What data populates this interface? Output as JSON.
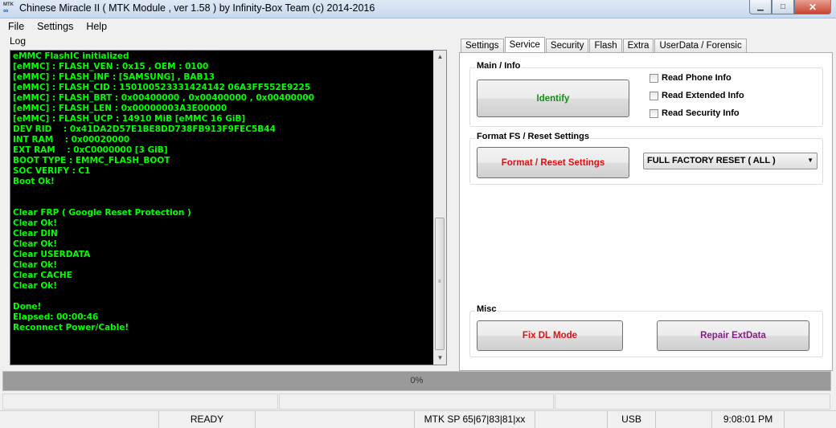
{
  "window": {
    "title": "Chinese Miracle II ( MTK Module , ver 1.58 ) by Infinity-Box Team (c) 2014-2016",
    "controls": [
      "minimize",
      "maximize",
      "close"
    ]
  },
  "menu": [
    "File",
    "Settings",
    "Help"
  ],
  "log": {
    "label": "Log",
    "lines": [
      "eMMC FlashIC initialized",
      "[eMMC] : FLASH_VEN : 0x15 , OEM : 0100",
      "[eMMC] : FLASH_INF : [SAMSUNG] , BAB13",
      "[eMMC] : FLASH_CID : 150100523331424142 06A3FF552E9225",
      "[eMMC] : FLASH_BRT : 0x00400000 , 0x00400000 , 0x00400000",
      "[eMMC] : FLASH_LEN : 0x00000003A3E00000",
      "[eMMC] : FLASH_UCP : 14910 MiB [eMMC 16 GiB]",
      "DEV RID    : 0x41DA2D57E1BE8DD738FB913F9FEC5B44",
      "INT RAM    : 0x00020000",
      "EXT RAM    : 0xC0000000 [3 GiB]",
      "BOOT TYPE : EMMC_FLASH_BOOT",
      "SOC VERIFY : C1",
      "Boot Ok!",
      "",
      "",
      "Clear FRP ( Google Reset Protection )",
      "Clear Ok!",
      "Clear DIN",
      "Clear Ok!",
      "Clear USERDATA",
      "Clear Ok!",
      "Clear CACHE",
      "Clear Ok!",
      "",
      "Done!",
      "Elapsed: 00:00:46",
      "Reconnect Power/Cable!"
    ]
  },
  "tabs": [
    "Settings",
    "Service",
    "Security",
    "Flash",
    "Extra",
    "UserData / Forensic"
  ],
  "active_tab": "Service",
  "service": {
    "main_info": {
      "title": "Main / Info",
      "identify_label": "Identify",
      "checkboxes": [
        "Read Phone Info",
        "Read Extended Info",
        "Read Security Info"
      ]
    },
    "format": {
      "title": "Format FS / Reset Settings",
      "button_label": "Format / Reset Settings",
      "selected_option": "FULL FACTORY RESET ( ALL )"
    },
    "misc": {
      "title": "Misc",
      "fix_dl_label": "Fix DL Mode",
      "repair_label": "Repair ExtData"
    }
  },
  "progress": {
    "text": "0%",
    "value": 0
  },
  "status": {
    "state": "READY",
    "platform": "MTK SP 65|67|83|81|xx",
    "connection": "USB",
    "time": "9:08:01 PM"
  },
  "colors": {
    "log_text": "#00ff00",
    "log_bg": "#000000",
    "identify": "#1a8a1a",
    "format": "#e01010",
    "fix_dl": "#e01010",
    "repair": "#8b1a8b"
  }
}
